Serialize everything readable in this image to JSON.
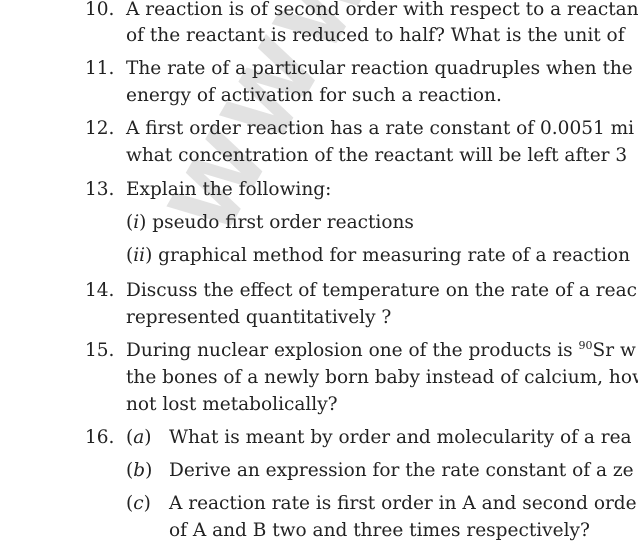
{
  "watermark": "WWW.JEE",
  "questions": [
    {
      "num": "10.",
      "lines": [
        "A reaction is of second order with respect to a reactant.",
        "of the reactant is reduced to half? What is the unit of"
      ]
    },
    {
      "num": "11.",
      "lines": [
        "The rate of a particular reaction quadruples when the",
        "energy of activation for such a reaction."
      ]
    },
    {
      "num": "12.",
      "lines": [
        "A first order reaction has a rate constant of 0.0051 mi",
        "what concentration of the reactant will be left after 3"
      ]
    },
    {
      "num": "13.",
      "lines": [
        "Explain the following:"
      ]
    },
    {
      "num": "14.",
      "lines": [
        "Discuss the effect of temperature on the rate of a reac",
        "represented quantitatively ?"
      ]
    },
    {
      "num": "15.",
      "lines": [
        "the bones of a newly born baby instead of calcium, how",
        "not lost metabolically?"
      ]
    },
    {
      "num": "16.",
      "lines": []
    }
  ],
  "q13_parts": [
    {
      "label": "i",
      "text": "pseudo first order reactions"
    },
    {
      "label": "ii",
      "text": "graphical method for measuring rate of a reaction"
    }
  ],
  "q15_first": {
    "before": "During nuclear explosion one of the products is ",
    "sup": "90",
    "after": "Sr w"
  },
  "q16_parts": [
    {
      "label": "a",
      "lines": [
        "What is meant by order and molecularity of a rea"
      ]
    },
    {
      "label": "b",
      "lines": [
        "Derive an expression for the rate constant of a ze"
      ]
    },
    {
      "label": "c",
      "lines": [
        "A reaction rate is first order in A and second orde",
        "of A and B two and three times respectively?"
      ]
    }
  ]
}
